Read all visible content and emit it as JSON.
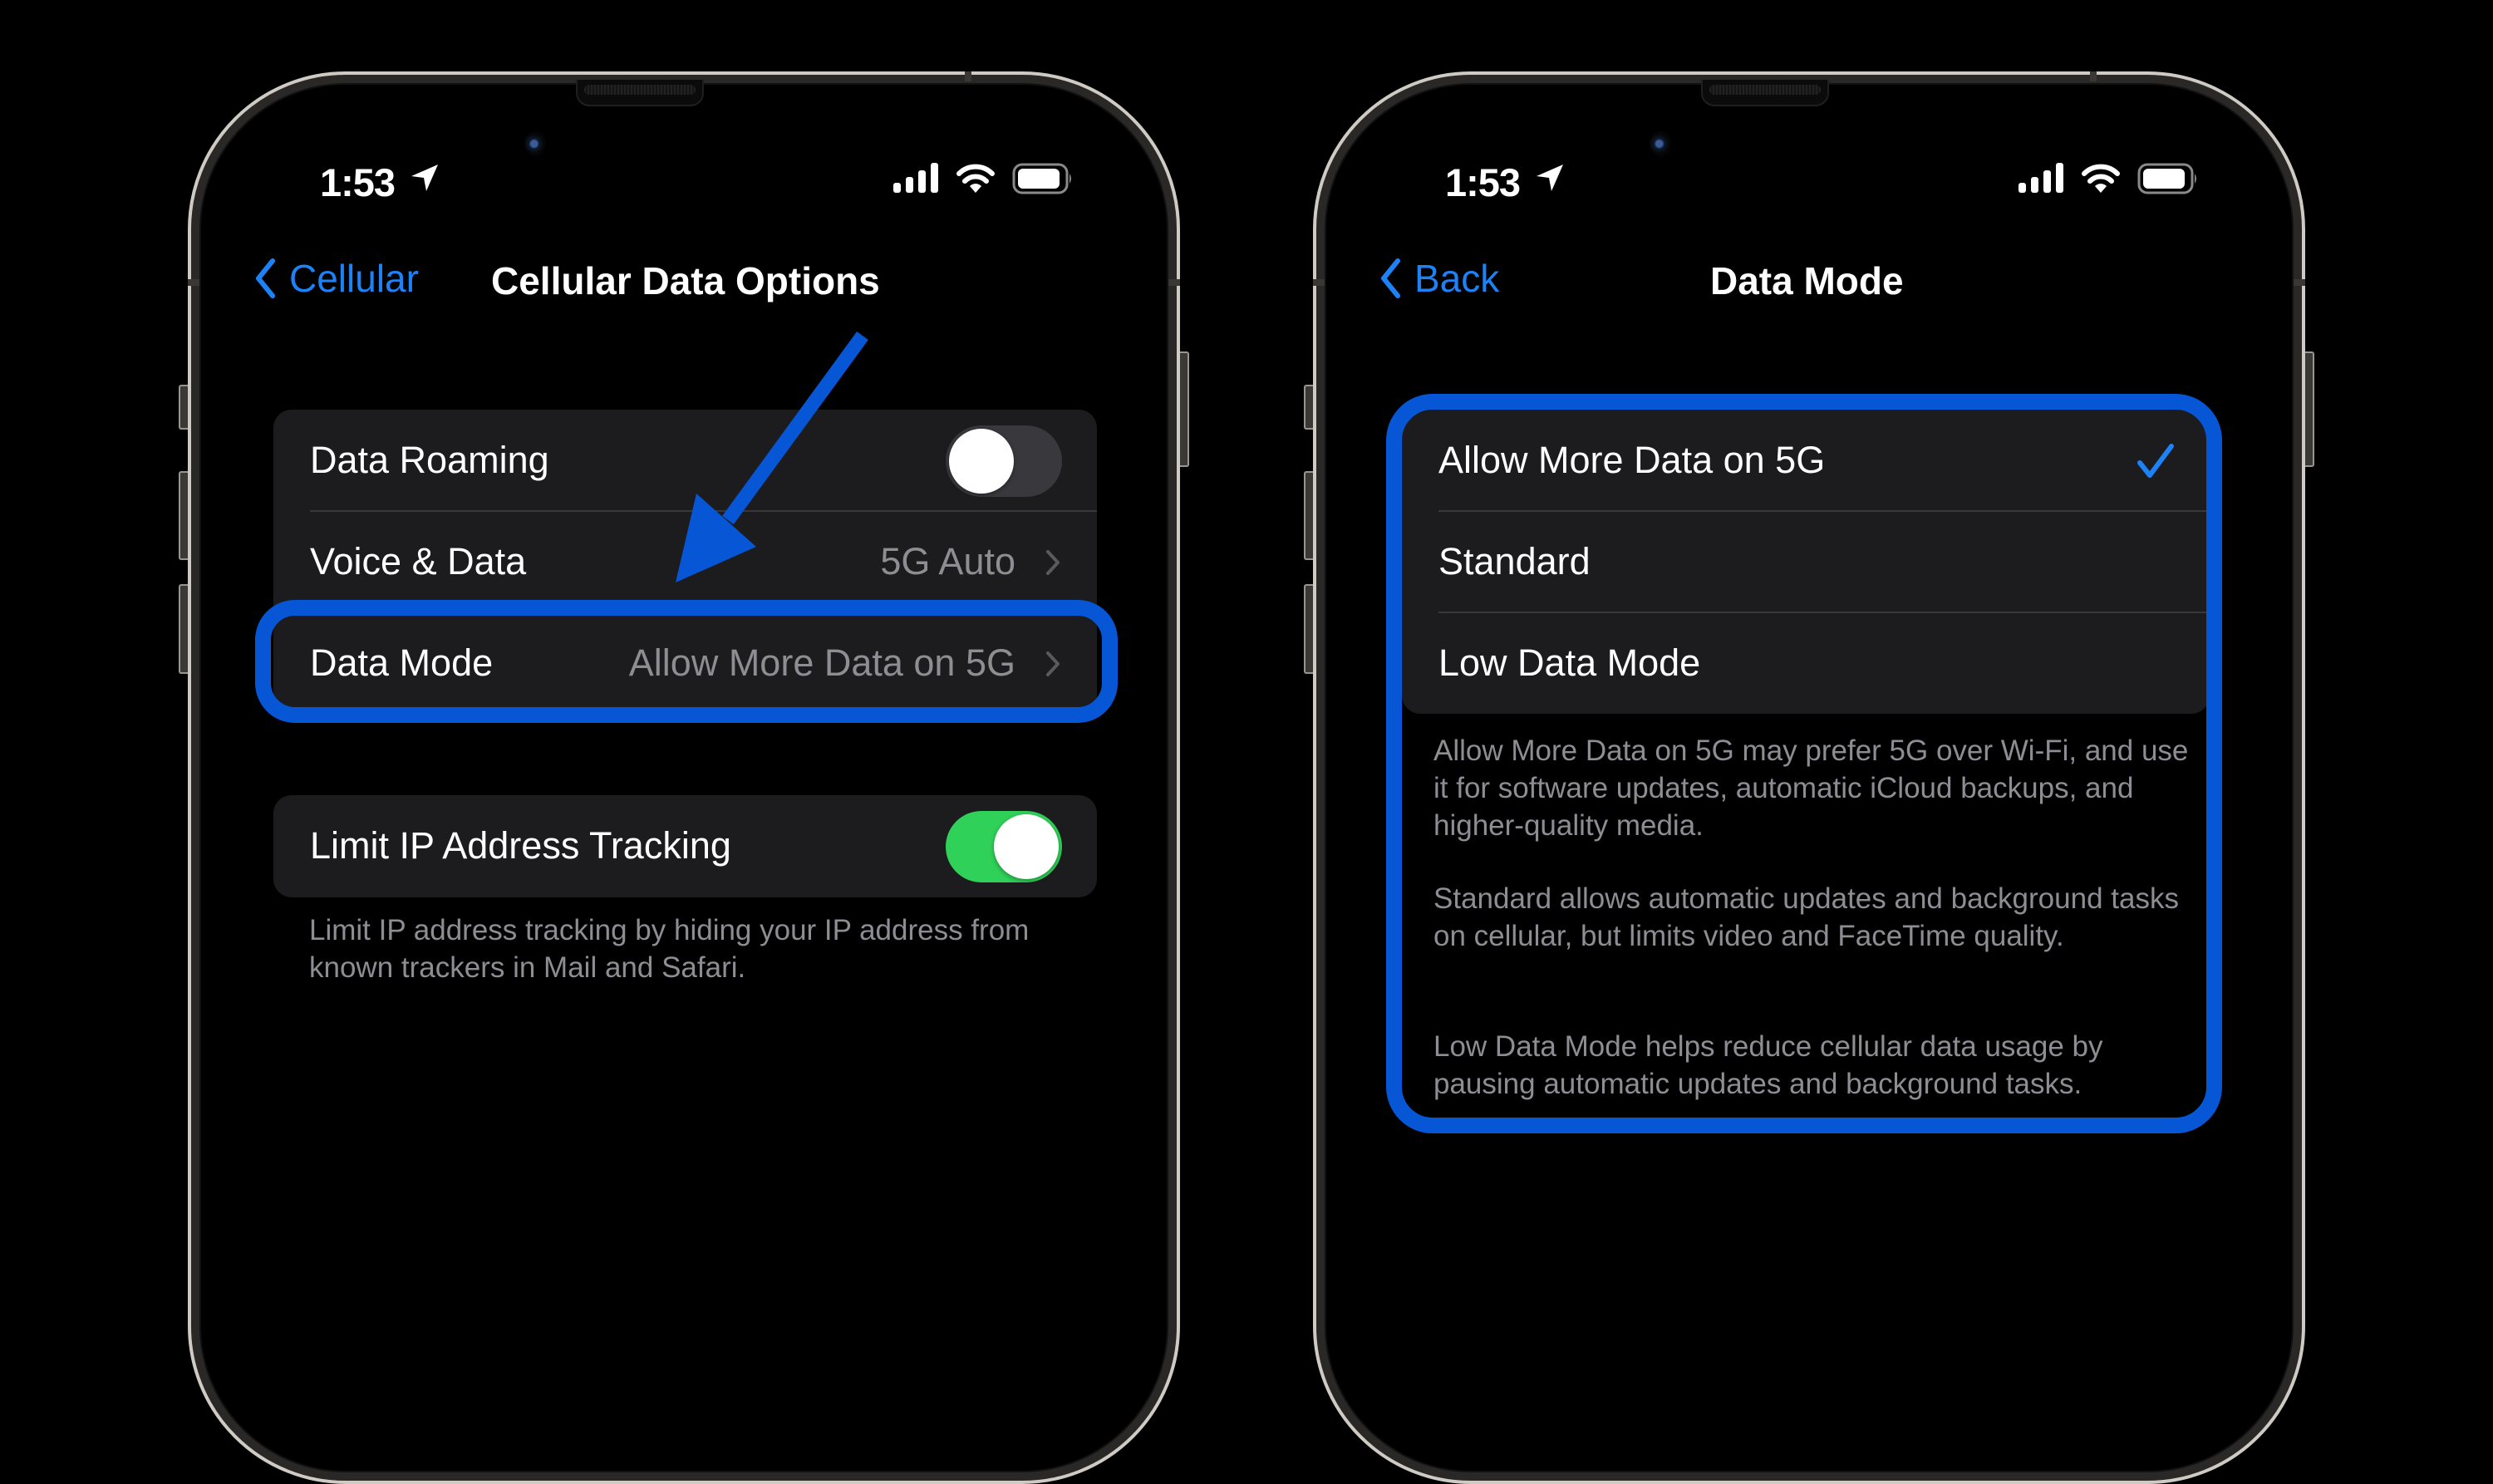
{
  "colors": {
    "accent_blue": "#1e82f7",
    "annotation_blue": "#0656d6",
    "toggle_on": "#30d158",
    "toggle_off": "#39393d",
    "card_bg": "#1c1c1e",
    "secondary_text": "#8d8d93"
  },
  "left_phone": {
    "status_bar": {
      "time": "1:53",
      "icons": [
        "location-arrow-icon",
        "cellular-signal-icon",
        "wifi-icon",
        "battery-icon"
      ]
    },
    "nav": {
      "back_label": "Cellular",
      "title": "Cellular Data Options"
    },
    "group1": {
      "rows": [
        {
          "label": "Data Roaming",
          "control": "toggle",
          "on": false
        },
        {
          "label": "Voice & Data",
          "value": "5G Auto",
          "control": "disclosure"
        },
        {
          "label": "Data Mode",
          "value": "Allow More Data on 5G",
          "control": "disclosure",
          "highlighted": true
        }
      ]
    },
    "group2": {
      "rows": [
        {
          "label": "Limit IP Address Tracking",
          "control": "toggle",
          "on": true
        }
      ],
      "footer": "Limit IP address tracking by hiding your IP address from known trackers in Mail and Safari."
    },
    "annotation": {
      "type": "arrow",
      "points_to": "Data Mode"
    }
  },
  "right_phone": {
    "status_bar": {
      "time": "1:53",
      "icons": [
        "location-arrow-icon",
        "cellular-signal-icon",
        "wifi-icon",
        "battery-icon"
      ]
    },
    "nav": {
      "back_label": "Back",
      "title": "Data Mode"
    },
    "options": [
      {
        "label": "Allow More Data on 5G",
        "selected": true
      },
      {
        "label": "Standard",
        "selected": false
      },
      {
        "label": "Low Data Mode",
        "selected": false
      }
    ],
    "footer": [
      "Allow More Data on 5G may prefer 5G over Wi-Fi, and use it for software updates, automatic iCloud backups, and higher-quality media.",
      "Standard allows automatic updates and background tasks on cellular, but limits video and FaceTime quality.",
      "Low Data Mode helps reduce cellular data usage by pausing automatic updates and background tasks."
    ],
    "annotation": {
      "type": "highlight-box",
      "surrounds": "options-and-footer"
    }
  }
}
